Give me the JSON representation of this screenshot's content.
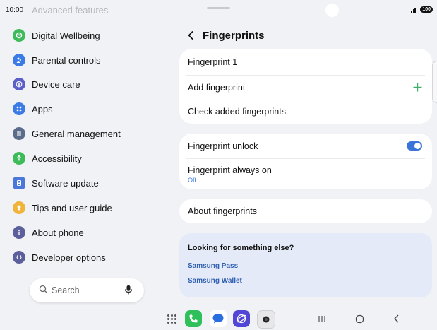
{
  "status_bar": {
    "time": "10:00",
    "battery": "100"
  },
  "sidebar": {
    "faded_item": "Advanced features",
    "items": [
      {
        "label": "Digital Wellbeing",
        "icon": "wellbeing-icon",
        "color": "#3dbb5a"
      },
      {
        "label": "Parental controls",
        "icon": "parental-controls-icon",
        "color": "#3a7be6"
      },
      {
        "label": "Device care",
        "icon": "device-care-icon",
        "color": "#5b5fc7"
      },
      {
        "label": "Apps",
        "icon": "apps-icon",
        "color": "#3a7be6"
      },
      {
        "label": "General management",
        "icon": "general-management-icon",
        "color": "#5b6b8c"
      },
      {
        "label": "Accessibility",
        "icon": "accessibility-icon",
        "color": "#3dbb5a"
      },
      {
        "label": "Software update",
        "icon": "software-update-icon",
        "color": "#4a78d8"
      },
      {
        "label": "Tips and user guide",
        "icon": "tips-icon",
        "color": "#f0b43a"
      },
      {
        "label": "About phone",
        "icon": "info-icon",
        "color": "#5b5f9c"
      },
      {
        "label": "Developer options",
        "icon": "developer-options-icon",
        "color": "#5b5f9c"
      }
    ],
    "search": {
      "label": "Search"
    }
  },
  "panel": {
    "title": "Fingerprints",
    "fingerprint_items": [
      "Fingerprint 1",
      "Add fingerprint",
      "Check added fingerprints"
    ],
    "unlock": {
      "label": "Fingerprint unlock",
      "enabled": true
    },
    "always_on": {
      "label": "Fingerprint always on",
      "value": "Off"
    },
    "about": "About fingerprints",
    "suggest": {
      "title": "Looking for something else?",
      "links": [
        "Samsung Pass",
        "Samsung Wallet"
      ]
    }
  },
  "colors": {
    "accent": "#3b74d8",
    "background": "#f1f2f6",
    "suggest_bg": "#e4eaf7",
    "link": "#2f5fb3"
  },
  "navbar": {
    "dock_apps": [
      "phone-app-icon",
      "messages-app-icon",
      "internet-app-icon",
      "camera-app-icon"
    ]
  }
}
